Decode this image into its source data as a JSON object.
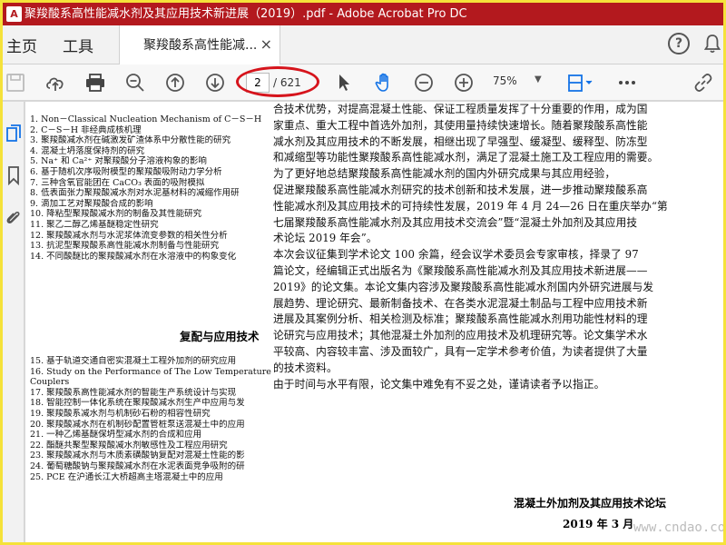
{
  "window": {
    "title": "聚羧酸系高性能减水剂及其应用技术新进展（2019）.pdf - Adobe Acrobat Pro DC",
    "logo_text": "A"
  },
  "menu": {
    "home": "主页",
    "tools": "工具"
  },
  "doc_tab": {
    "label": "聚羧酸系高性能减...",
    "close": "×"
  },
  "help": {
    "label": "?"
  },
  "toolbar": {
    "current_page": "2",
    "total_pages": "/ 621",
    "zoom": "75%"
  },
  "toc_part1": [
    "1.  Non－Classical Nucleation Mechanism of C－S－H",
    "2.  C－S－H 非经典成核机理",
    "3.  聚羧酸减水剂在碱激发矿渣体系中分散性能的研究",
    "4.  混凝土坍落度保持剂的研究",
    "5.  Na⁺ 和 Ca²⁺ 对聚羧酸分子溶液构象的影响",
    "6.  基于随机次序吸附模型的聚羧酸吸附动力学分析",
    "7.  三种含氧官能团在 CaCO₃ 表面的吸附模拟",
    "8.  低表面张力聚羧酸减水剂对水泥基材料的减缩作用研",
    "9.  滴加工艺对聚羧酸合成的影响",
    "10.  降粘型聚羧酸减水剂的制备及其性能研究",
    "11.  聚乙二醇乙烯基醚稳定性研究",
    "12.  聚羧酸减水剂与水泥浆体流变参数的相关性分析",
    "13.  抗泥型聚羧酸系高性能减水剂制备与性能研究",
    "14.  不同酸醚比的聚羧酸减水剂在水溶液中的构象变化"
  ],
  "toc_section_title": "复配与应用技术",
  "toc_part2": [
    "15.  基于轨道交通自密实混凝土工程外加剂的研究应用",
    "16.  Study on the Performance of The Low Temperature Ceme",
    "      Couplers",
    "17.  聚羧酸系高性能减水剂的智能生产系统设计与实现",
    "18.  智能控制一体化系统在聚羧酸减水剂生产中应用与发",
    "19.  聚羧酸系减水剂与机制砂石粉的相容性研究",
    "20.  聚羧酸减水剂在机制砂配置管桩泵送混凝土中的应用",
    "21.  一种乙烯基醚保坍型减水剂的合成和应用",
    "22.  酯醚共聚型聚羧酸减水剂敏感性及工程应用研究",
    "23.  聚羧酸减水剂与木质素磺酸钠复配对混凝土性能的影",
    "24.  葡萄糖酸钠与聚羧酸减水剂在水泥表面竞争吸附的研",
    "25.  PCE 在沪通长江大桥超高主塔混凝土中的应用"
  ],
  "body_lines": [
    "合技术优势，对提高混凝土性能、保证工程质量发挥了十分重要的作用，成为国",
    "家重点、重大工程中首选外加剂，其使用量持续快速增长。随着聚羧酸系高性能",
    "减水剂及其应用技术的不断发展，相继出现了早强型、缓凝型、缓释型、防冻型",
    "和减缩型等功能性聚羧酸系高性能减水剂，满足了混凝土施工及工程应用的需要。",
    "    为了更好地总结聚羧酸系高性能减水剂的国内外研究成果与其应用经验，",
    "促进聚羧酸系高性能减水剂研究的技术创新和技术发展，进一步推动聚羧酸系高",
    "性能减水剂及其应用技术的可持续性发展，2019 年 4 月 24—26 日在重庆举办“第",
    "七届聚羧酸系高性能减水剂及其应用技术交流会”暨“混凝土外加剂及其应用技",
    "术论坛 2019 年会”。",
    "    本次会议征集到学术论文 100 余篇，经会议学术委员会专家审核，择录了 97",
    "篇论文，经编辑正式出版名为《聚羧酸系高性能减水剂及其应用技术新进展——",
    "2019》的论文集。本论文集内容涉及聚羧酸系高性能减水剂国内外研究进展与发",
    "展趋势、理论研究、最新制备技术、在各类水泥混凝土制品与工程中应用技术新",
    "进展及其案例分析、相关检测及标准；聚羧酸系高性能减水剂用功能性材料的理",
    "论研究与应用技术；其他混凝土外加剂的应用技术及机理研究等。论文集学术水",
    "平较高、内容较丰富、涉及面较广，具有一定学术参考价值，为读者提供了大量",
    "的技术资料。",
    "    由于时间与水平有限，论文集中难免有不妥之处，谨请读者予以指正。"
  ],
  "signature": "混凝土外加剂及其应用技术论坛",
  "signature_date": "2019 年 3 月",
  "watermark": "www.cndao.com",
  "colors": {
    "titlebar": "#b3191e",
    "annotation_oval": "#d6141c",
    "selected_tool": "#1473e6"
  }
}
